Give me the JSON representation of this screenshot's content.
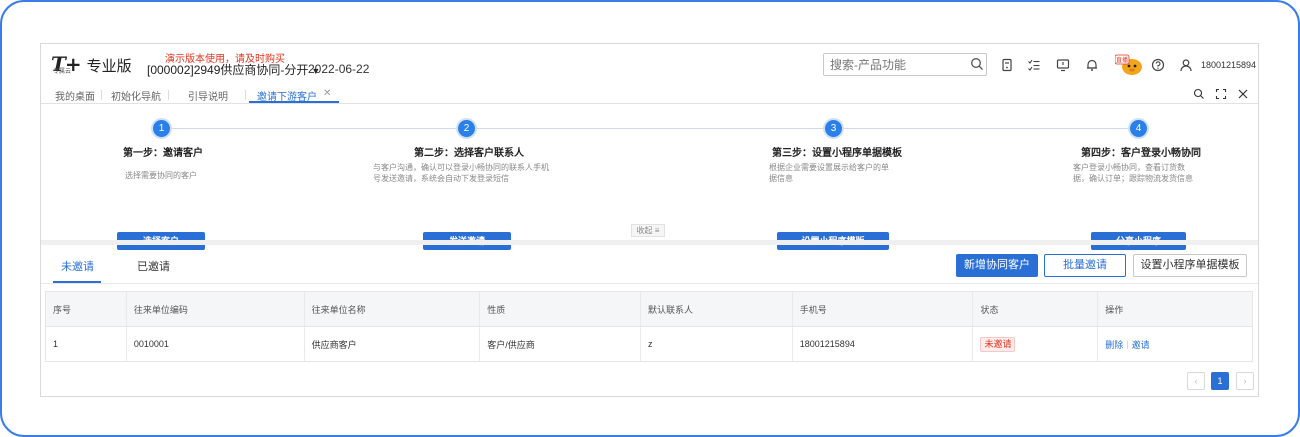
{
  "header": {
    "logo_mark": "T+",
    "logo_sub": "专属云",
    "edition": "专业版",
    "warning": "演示版本使用，请及时购买",
    "company": "[000002]2949供应商协同-分开",
    "date": "2022-06-22",
    "search_placeholder": "搜索-产品功能",
    "mascot_badge": "直播",
    "user": "18001215894"
  },
  "tabs": [
    {
      "label": "我的桌面"
    },
    {
      "label": "初始化导航"
    },
    {
      "label": "引导说明"
    },
    {
      "label": "邀请下游客户"
    }
  ],
  "steps": [
    {
      "num": "1",
      "title": "第一步：邀请客户",
      "desc": [
        "选择需要协同的客户"
      ],
      "button": "选择客户"
    },
    {
      "num": "2",
      "title": "第二步：选择客户联系人",
      "desc": [
        "与客户沟通，确认可以登录小畅协同的联系人手机",
        "号发送邀请，系统会自动下发登录短信"
      ],
      "button": "发送邀请"
    },
    {
      "num": "3",
      "title": "第三步：设置小程序单据模板",
      "desc": [
        "根据企业需要设置展示给客户的单",
        "据信息"
      ],
      "button": "设置小程序模版"
    },
    {
      "num": "4",
      "title": "第四步：客户登录小畅协同",
      "desc": [
        "客户登录小畅协同，查看订货数",
        "据，确认订单；跟踪物流发货信息"
      ],
      "button": "分享小程序"
    }
  ],
  "collapse_label": "收起 ≡",
  "invite_tabs": [
    {
      "label": "未邀请"
    },
    {
      "label": "已邀请"
    }
  ],
  "actions": {
    "add": "新增协同客户",
    "batch": "批量邀请",
    "template": "设置小程序单据模板"
  },
  "table": {
    "columns": [
      "序号",
      "往来单位编码",
      "往来单位名称",
      "性质",
      "默认联系人",
      "手机号",
      "状态",
      "操作"
    ],
    "rows": [
      {
        "idx": "1",
        "code": "0010001",
        "name": "供应商客户",
        "nature": "客户/供应商",
        "contact": "z",
        "phone": "18001215894",
        "status": "未邀请",
        "op_delete": "删除",
        "op_invite": "邀请"
      }
    ]
  },
  "pagination": {
    "prev": "‹",
    "current": "1",
    "next": "›"
  },
  "colors": {
    "accent": "#2a6fd6",
    "frame": "#3a7de8",
    "warning": "#e0341e"
  }
}
